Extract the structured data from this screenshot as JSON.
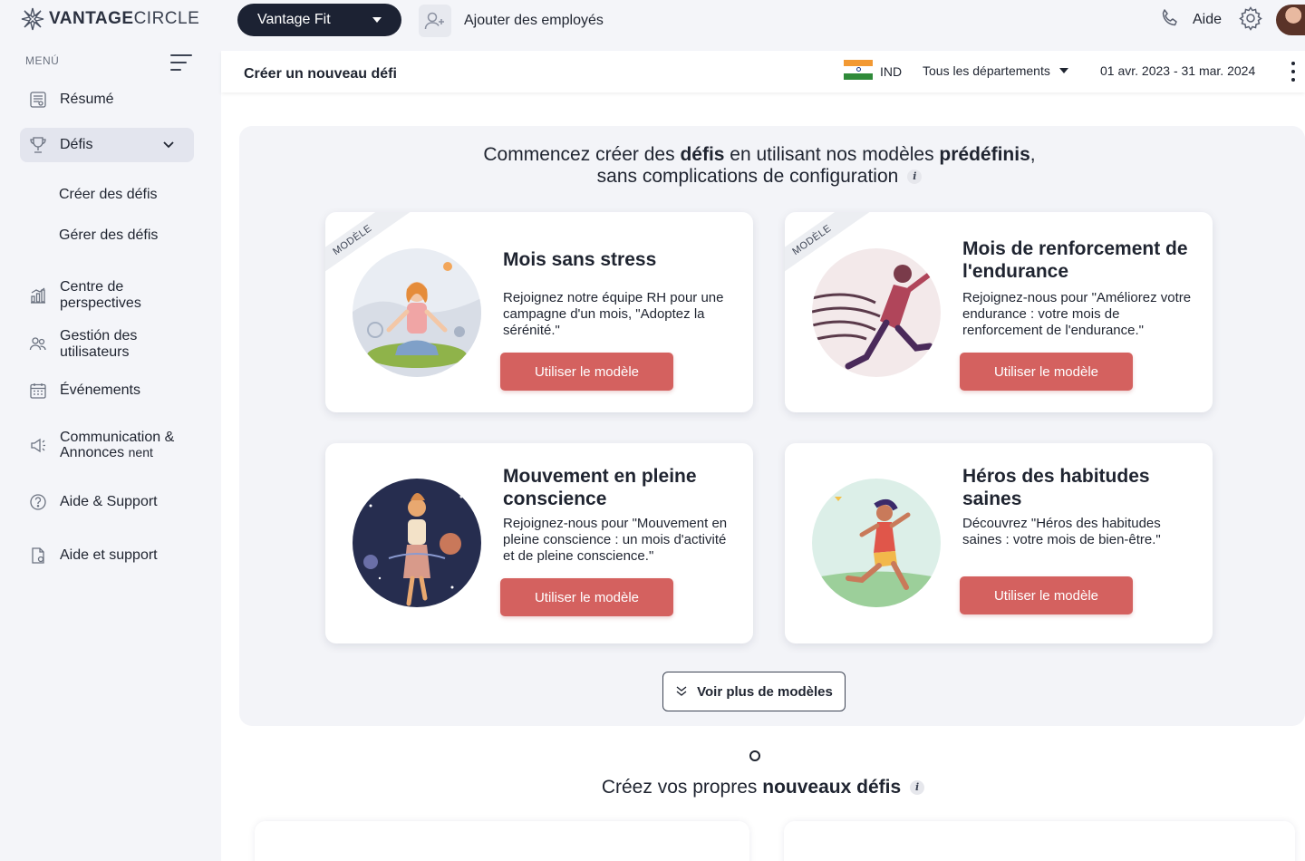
{
  "brand": {
    "name_bold": "VANTAGE",
    "name_light": "CIRCLE"
  },
  "topbar": {
    "program": "Vantage Fit",
    "add_employees": "Ajouter des employés",
    "help": "Aide"
  },
  "sidebar": {
    "menu_label": "MENÚ",
    "items": [
      {
        "label": "Résumé",
        "icon": "report-icon"
      },
      {
        "label": "Défis",
        "icon": "trophy-icon"
      },
      {
        "label": "Centre de perspectives",
        "icon": "bar-chart-icon"
      },
      {
        "label": "Gestión des utilisateurs",
        "icon": "users-icon"
      },
      {
        "label": "Événements",
        "icon": "calendar-icon"
      },
      {
        "label_line1": "Communication &",
        "label_line2": "Annonces",
        "label_tail": "nent",
        "icon": "megaphone-icon"
      },
      {
        "label": "Aide & Support",
        "icon": "question-icon"
      },
      {
        "label": "Aide et support",
        "icon": "document-icon"
      }
    ],
    "sub_items": [
      "Créer des défis",
      "Gérer des défis"
    ]
  },
  "subheader": {
    "title": "Créer un nouveau défi",
    "country": "IND",
    "department": "Tous les départements",
    "date_range": "01 avr. 2023 - 31 mar. 2024"
  },
  "intro": {
    "part1": "Commencez ",
    "part1b": "créer des ",
    "bold1": "défis",
    "part2": " en utilisant nos modèles ",
    "bold2": "prédéfinis",
    "part3": ",",
    "line2": "sans complications de configuration"
  },
  "ribbon_label": "MODÈLE",
  "cards": [
    {
      "title": "Mois sans stress",
      "description": "Rejoignez notre équipe RH pour une campagne d'un mois, \"Adoptez la sérénité.\"",
      "button": "Utiliser le modèle"
    },
    {
      "title": "Mois de renforcement de l'endurance",
      "description": "Rejoignez-nous pour \"Améliorez votre endurance : votre mois de renforcement de l'endurance.\"",
      "button": "Utiliser le modèle"
    },
    {
      "title": "Mouvement en pleine conscience",
      "description": "Rejoignez-nous pour \"Mouvement en pleine conscience : un mois d'activité et de pleine conscience.\"",
      "button": "Utiliser le modèle"
    },
    {
      "title": "Héros des habitudes saines",
      "description": "Découvrez \"Héros des habitudes saines : votre mois de bien-être.\"",
      "button": "Utiliser le modèle"
    }
  ],
  "more_templates": "Voir plus de modèles",
  "own": {
    "part1": "Créez vos propres ",
    "bold": "nouveaux défis"
  },
  "colors": {
    "accent": "#d4615f",
    "dark": "#1c2233",
    "panel": "#f3f4f8"
  }
}
